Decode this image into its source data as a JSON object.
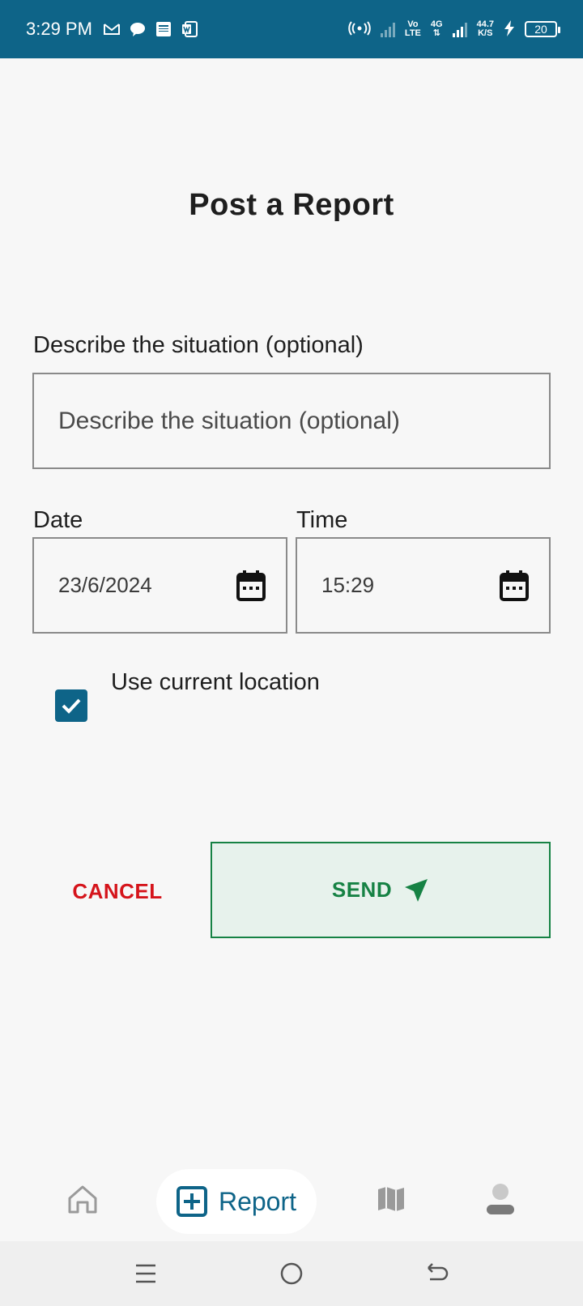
{
  "status_bar": {
    "time": "3:29 PM",
    "network_type_top": "Vo",
    "network_type_bottom": "LTE",
    "data_top": "4G",
    "data_bottom": "⇅",
    "speed_top": "44.7",
    "speed_bottom": "K/S",
    "battery": "20",
    "icons_left": [
      "gmail-icon",
      "chat-icon",
      "news-icon",
      "word-icon"
    ],
    "icons_right": [
      "hotspot-icon",
      "signal-icon",
      "signal-icon",
      "charging-icon",
      "battery-icon"
    ]
  },
  "page": {
    "title": "Post a Report"
  },
  "form": {
    "description_label": "Describe the situation (optional)",
    "description_placeholder": "Describe the situation (optional)",
    "date_label": "Date",
    "date_value": "23/6/2024",
    "time_label": "Time",
    "time_value": "15:29",
    "use_location_label": "Use current location",
    "use_location_checked": true
  },
  "actions": {
    "cancel_label": "CANCEL",
    "send_label": "SEND"
  },
  "bottom_nav": {
    "items": [
      {
        "name": "home",
        "icon": "home-icon",
        "label": ""
      },
      {
        "name": "report",
        "icon": "add-box-icon",
        "label": "Report",
        "active": true
      },
      {
        "name": "map",
        "icon": "map-icon",
        "label": ""
      },
      {
        "name": "profile",
        "icon": "person-icon",
        "label": ""
      }
    ]
  },
  "system_nav": {
    "items": [
      "menu-icon",
      "home-circle-icon",
      "back-icon"
    ]
  },
  "colors": {
    "primary": "#0e6488",
    "cancel": "#d5141b",
    "send": "#168244",
    "send_bg": "#e7f2ec",
    "background": "#f7f7f7"
  }
}
